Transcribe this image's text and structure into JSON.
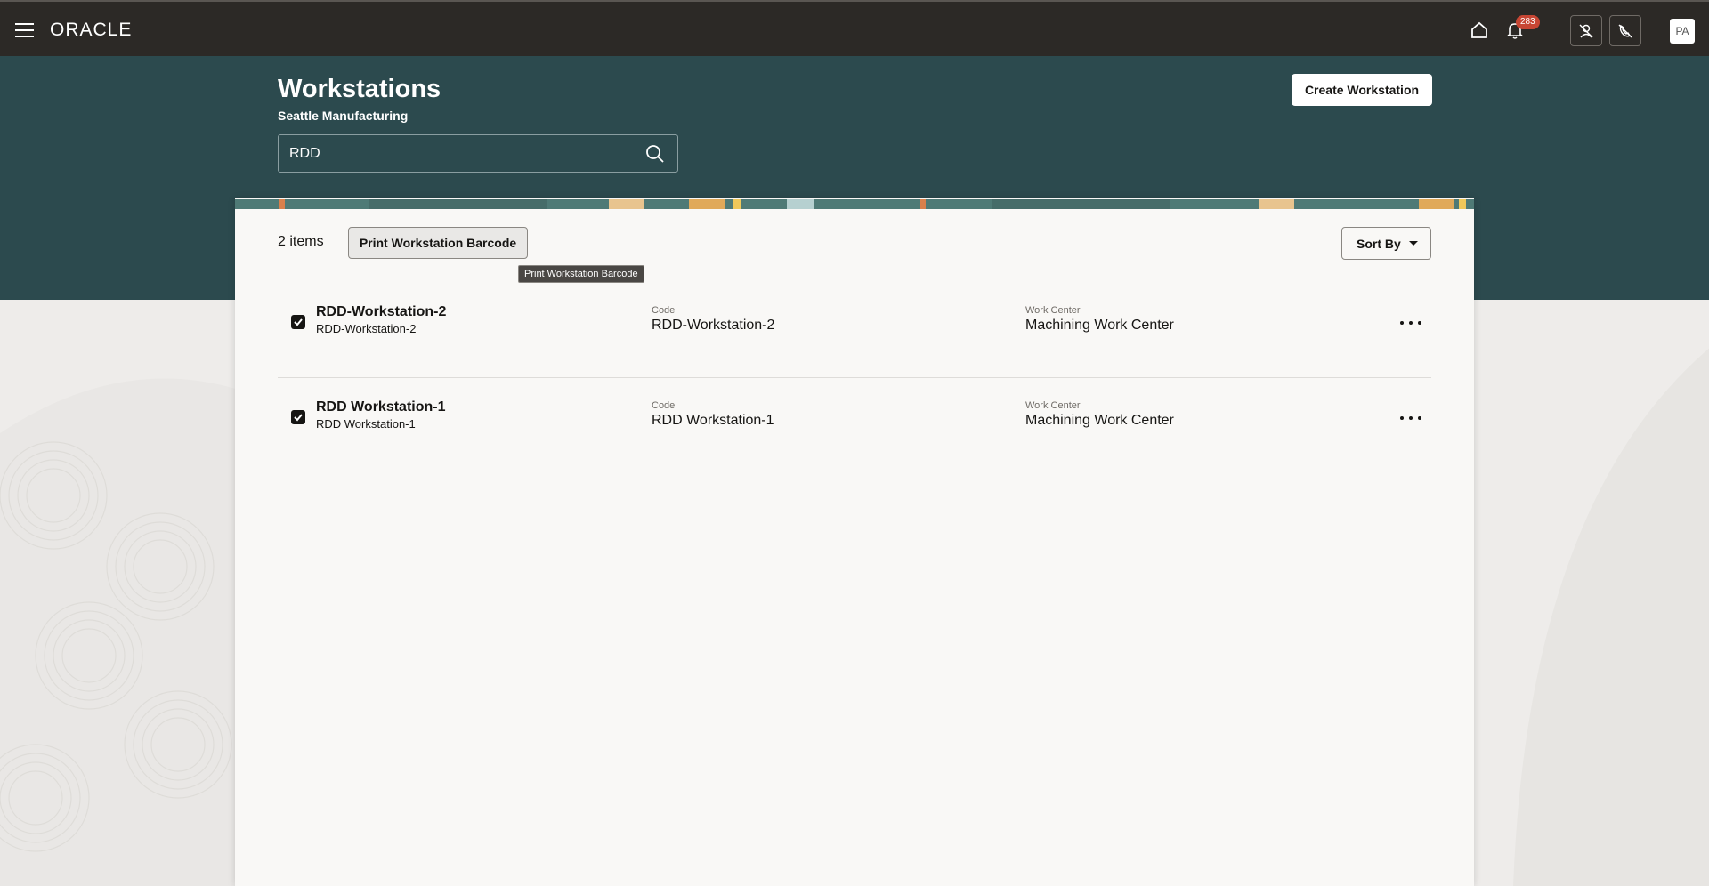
{
  "topbar": {
    "brand": "ORACLE",
    "notifications_count": "283",
    "user_initials": "PA",
    "icons": [
      "menu-icon",
      "home-icon",
      "bell-icon",
      "person-slash-icon",
      "phone-slash-icon"
    ]
  },
  "header": {
    "title": "Workstations",
    "subtitle": "Seattle Manufacturing",
    "search_value": "RDD",
    "create_label": "Create Workstation"
  },
  "toolbar": {
    "items_count": "2 items",
    "print_label": "Print Workstation Barcode",
    "tooltip": "Print Workstation Barcode",
    "sort_label": "Sort By"
  },
  "rows": [
    {
      "title": "RDD-Workstation-2",
      "subtitle": "RDD-Workstation-2",
      "code_label": "Code",
      "code": "RDD-Workstation-2",
      "wc_label": "Work Center",
      "work_center": "Machining Work Center",
      "checked": true
    },
    {
      "title": "RDD Workstation-1",
      "subtitle": "RDD Workstation-1",
      "code_label": "Code",
      "code": "RDD Workstation-1",
      "wc_label": "Work Center",
      "work_center": "Machining Work Center",
      "checked": true
    }
  ],
  "colors": {
    "topbar": "#2c2926",
    "banner": "#2c4a4e",
    "badge": "#c74634",
    "card": "#f9f8f6"
  }
}
